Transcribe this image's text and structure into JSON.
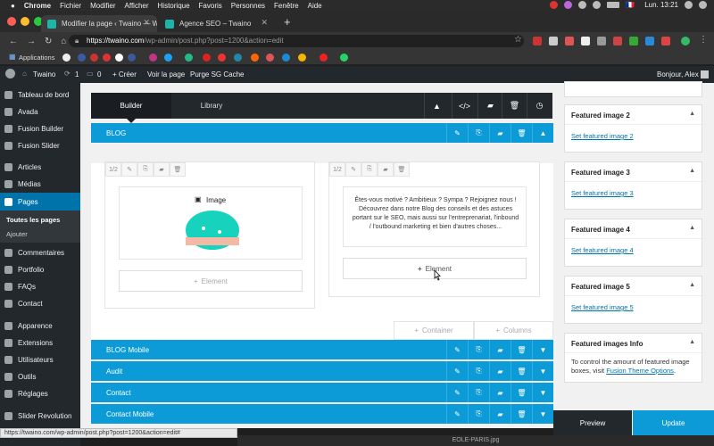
{
  "os_menu": {
    "apple": "",
    "items": [
      "Chrome",
      "Fichier",
      "Modifier",
      "Afficher",
      "Historique",
      "Favoris",
      "Personnes",
      "Fenêtre",
      "Aide"
    ],
    "flag": "🇫🇷",
    "clock": "Lun. 13:21"
  },
  "browser": {
    "tabs": [
      {
        "title": "Modifier la page ‹ Twaino — W"
      },
      {
        "title": "Agence SEO – Twaino"
      }
    ],
    "new_tab": "+",
    "url_host": "https://twaino.com",
    "url_path": "/wp-admin/post.php?post=1200&action=edit",
    "applications_label": "Applications",
    "status_url": "https://twaino.com/wp-admin/post.php?post=1200&action=edit#",
    "download_name": "EOLE-PARIS.jpg"
  },
  "adminbar": {
    "site": "Twaino",
    "updates": "1",
    "comments": "0",
    "new": "+ Créer",
    "view": "Voir la page",
    "purge": "Purge SG Cache",
    "greeting": "Bonjour, Alex"
  },
  "sidebar": {
    "items": [
      {
        "label": "Tableau de bord"
      },
      {
        "label": "Avada"
      },
      {
        "label": "Fusion Builder"
      },
      {
        "label": "Fusion Slider"
      },
      {
        "label": "Articles"
      },
      {
        "label": "Médias"
      },
      {
        "label": "Pages"
      },
      {
        "label": "Commentaires"
      },
      {
        "label": "Portfolio"
      },
      {
        "label": "FAQs"
      },
      {
        "label": "Contact"
      },
      {
        "label": "Apparence"
      },
      {
        "label": "Extensions"
      },
      {
        "label": "Utilisateurs"
      },
      {
        "label": "Outils"
      },
      {
        "label": "Réglages"
      },
      {
        "label": "Slider Revolution"
      }
    ],
    "sub": [
      "Toutes les pages",
      "Ajouter"
    ]
  },
  "builder": {
    "tab_builder": "Builder",
    "tab_library": "Library",
    "sections": [
      "BLOG",
      "BLOG Mobile",
      "Audit",
      "Contact",
      "Contact Mobile"
    ],
    "col_size_1": "1/2",
    "col_size_2": "1/2",
    "image_title": "Image",
    "text_preview": "Êtes-vous motivé ? Ambitieux ? Sympa ? Rejoignez nous ! Découvrez dans notre Blog des conseils et des astuces portant sur le SEO, mais aussi sur l'entreprenariat, l'inbound / l'outbound marketing et bien d'autres choses...",
    "add_element": "Element",
    "add_container": "Container",
    "add_columns": "Columns"
  },
  "right_panel": {
    "cards": [
      {
        "title": "Featured image 2",
        "link": "Set featured image 2"
      },
      {
        "title": "Featured image 3",
        "link": "Set featured image 3"
      },
      {
        "title": "Featured image 4",
        "link": "Set featured image 4"
      },
      {
        "title": "Featured image 5",
        "link": "Set featured image 5"
      }
    ],
    "info_title": "Featured images Info",
    "info_text": "To control the amount of featured image boxes, visit",
    "info_link": "Fusion Theme Options",
    "info_end": ".",
    "preview": "Preview",
    "update": "Update"
  },
  "colors": {
    "accent": "#0c9bd7",
    "dark": "#23282d",
    "link": "#0073aa"
  }
}
